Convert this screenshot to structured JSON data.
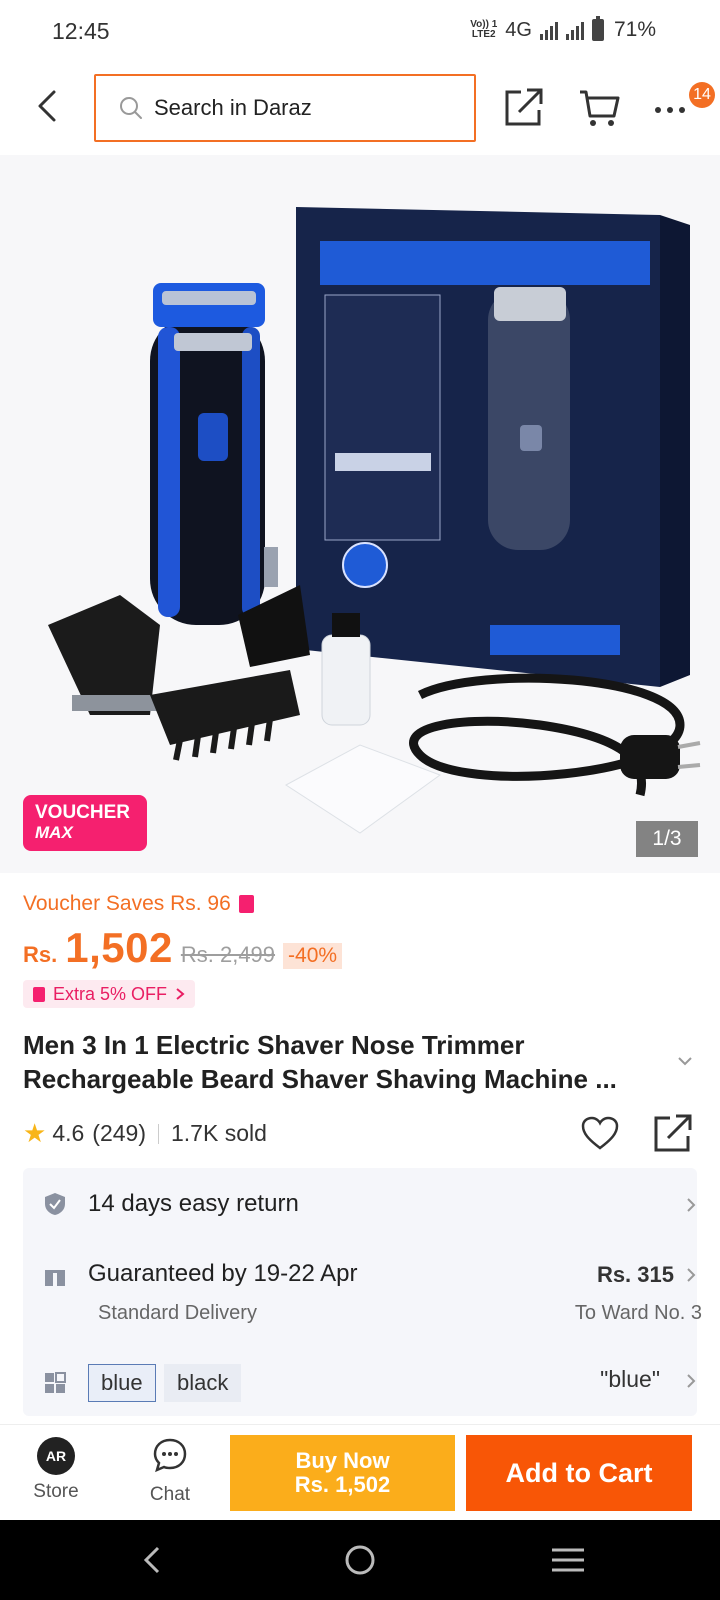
{
  "status_bar": {
    "time": "12:45",
    "network_lte_top": "Vo)) 1",
    "network_lte_bottom": "LTE2",
    "network_type": "4G",
    "battery": "71%"
  },
  "header": {
    "search_placeholder": "Search in Daraz",
    "cart_badge_count": "14"
  },
  "gallery": {
    "voucher_line1": "VOUCHER",
    "voucher_line2": "MAX",
    "counter": "1/3"
  },
  "product": {
    "voucher_saves": "Voucher Saves Rs. 96",
    "currency": "Rs.",
    "price": "1,502",
    "original_price": "Rs. 2,499",
    "discount": "-40%",
    "extra_off": "Extra 5% OFF",
    "title": "Men 3 In 1 Electric Shaver Nose Trimmer Rechargeable Beard Shaver Shaving Machine ...",
    "rating": "4.6",
    "review_count": "(249)",
    "sold": "1.7K sold"
  },
  "services": {
    "return": "14 days easy return",
    "delivery_title": "Guaranteed by 19-22 Apr",
    "delivery_type": "Standard Delivery",
    "delivery_price": "Rs. 315",
    "delivery_location": "To Ward No. 3",
    "variants": [
      "blue",
      "black"
    ],
    "selected_variant": "\"blue\""
  },
  "bottom_bar": {
    "store_label": "Store",
    "store_avatar": "AR",
    "chat_label": "Chat",
    "buy_now_line1": "Buy Now",
    "buy_now_line2": "Rs. 1,502",
    "add_to_cart": "Add to Cart"
  },
  "colors": {
    "accent": "#f36f24",
    "buy_now": "#fbad1b",
    "add_to_cart": "#f85606",
    "voucher": "#f5206f"
  },
  "icons": [
    "back-icon",
    "search-icon",
    "share-icon",
    "cart-icon",
    "more-icon",
    "star-icon",
    "heart-icon",
    "shield-icon",
    "gift-icon",
    "variant-grid-icon",
    "chat-icon",
    "chevron-right-icon",
    "nav-back-icon",
    "nav-home-icon",
    "nav-menu-icon"
  ]
}
